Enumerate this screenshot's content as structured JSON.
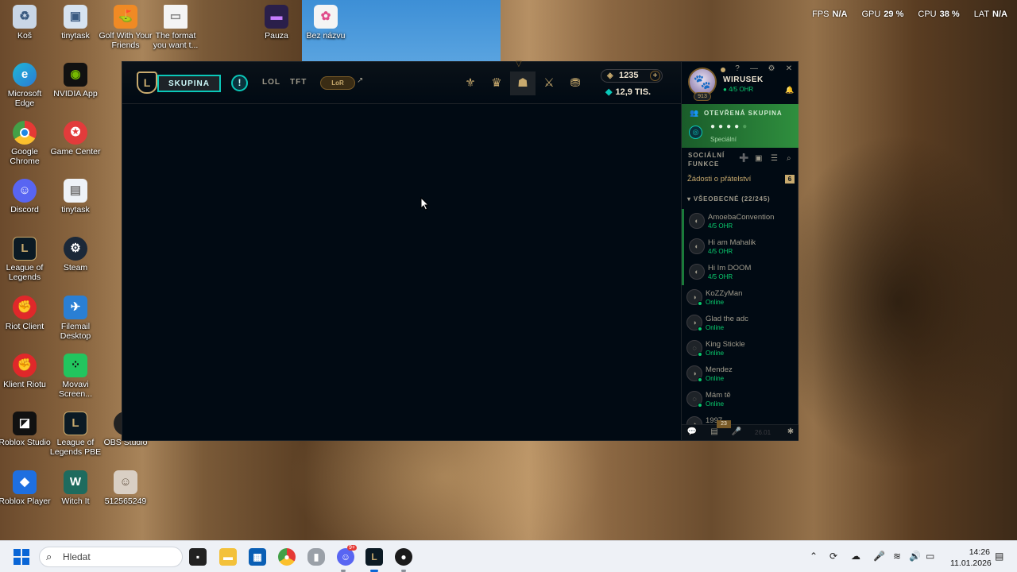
{
  "overlay": {
    "fps_label": "FPS",
    "fps_value": "N/A",
    "gpu_label": "GPU",
    "gpu_value": "29 %",
    "cpu_label": "CPU",
    "cpu_value": "38 %",
    "lat_label": "LAT",
    "lat_value": "N/A"
  },
  "desktop_icons": {
    "kos": "Koš",
    "tinytask": "tinytask",
    "golf": "Golf With Your Friends",
    "format": "The format you want t...",
    "pauza": "Pauza",
    "beznazvu": "Bez názvu",
    "edge": "Microsoft Edge",
    "nvidia": "NVIDIA App",
    "chrome": "Google Chrome",
    "gamecenter": "Game Center",
    "discord": "Discord",
    "tinytask2": "tinytask",
    "lol": "League of Legends",
    "steam": "Steam",
    "riot": "Riot Client",
    "filemail": "Filemail Desktop",
    "klient": "Klient Riotu",
    "movavi": "Movavi Screen...",
    "roblox_studio": "Roblox Studio",
    "lol_pbe": "League of Legends PBE",
    "obs": "OBS Studio",
    "roblox_player": "Roblox Player",
    "witchit": "Witch It",
    "photo": "512565249"
  },
  "client": {
    "play_label": "SKUPINA",
    "alert_glyph": "!",
    "tab_lol": "LOL",
    "tab_tft": "TFT",
    "lor_label": "LoR",
    "rp_value": "1235",
    "be_value": "12,9 TIS.",
    "profile": {
      "name": "WIRUSEK",
      "status": "4/5 OHR",
      "level": "913"
    },
    "lobby": {
      "title": "OTEVŘENÁ SKUPINA",
      "subtitle": "Speciální"
    },
    "social_title_1": "SOCIÁLNÍ",
    "social_title_2": "FUNKCE",
    "requests_label": "Žádosti o přátelství",
    "requests_count": "6",
    "group_label": "VŠEOBECNÉ (22/245)",
    "friends": [
      {
        "name": "AmoebaConvention",
        "status": "4/5 OHR"
      },
      {
        "name": "Hi am Mahalik",
        "status": "4/5 OHR"
      },
      {
        "name": "Hi Im DOOM",
        "status": "4/5 OHR"
      },
      {
        "name": "KoZZyMan",
        "status": "Online"
      },
      {
        "name": "Glad the adc",
        "status": "Online"
      },
      {
        "name": "King Stickle",
        "status": "Online"
      },
      {
        "name": "Mendez",
        "status": "Online"
      },
      {
        "name": "Mám tě",
        "status": "Online"
      },
      {
        "name": "1997",
        "status": ""
      }
    ],
    "footer_badge": "23",
    "footer_version": "26.01"
  },
  "taskbar": {
    "search_placeholder": "Hledat",
    "time": "14:26",
    "date": "11.01.2026",
    "discord_badge": "9+"
  }
}
